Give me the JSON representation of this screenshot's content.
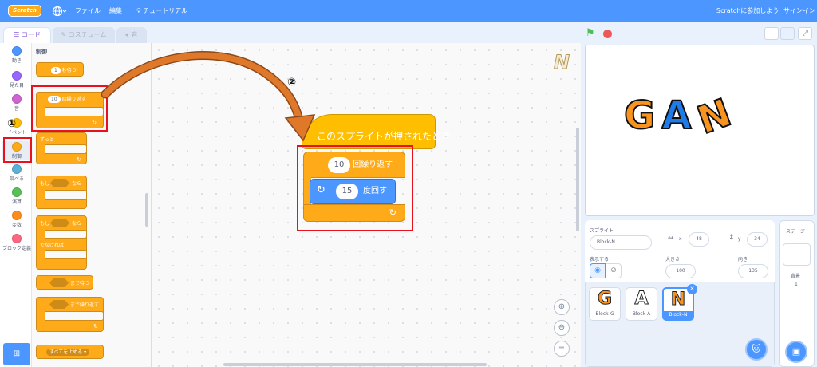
{
  "menubar": {
    "logo": "Scratch",
    "file": "ファイル",
    "edit": "編集",
    "tutorial": "チュートリアル",
    "join": "Scratchに参加しよう",
    "signin": "サインイン"
  },
  "tabs": {
    "code": "コード",
    "costume": "コスチューム",
    "sound": "音"
  },
  "categories": [
    {
      "label": "動き",
      "color": "#4c97ff"
    },
    {
      "label": "見た目",
      "color": "#9966ff"
    },
    {
      "label": "音",
      "color": "#cf63cf"
    },
    {
      "label": "イベント",
      "color": "#ffbf00"
    },
    {
      "label": "制御",
      "color": "#ffab19"
    },
    {
      "label": "調べる",
      "color": "#5cb1d6"
    },
    {
      "label": "演算",
      "color": "#59c059"
    },
    {
      "label": "変数",
      "color": "#ff8c1a"
    },
    {
      "label": "ブロック定義",
      "color": "#ff6680"
    }
  ],
  "palette": {
    "heading": "制御",
    "wait_num": "1",
    "wait_label": "秒待つ",
    "repeat_num": "10",
    "repeat_label": "回繰り返す",
    "forever": "ずっと",
    "if_then_if": "もし",
    "if_then_then": "なら",
    "if_else_if": "もし",
    "if_else_then": "なら",
    "else": "でなければ",
    "wait_until": "まで待つ",
    "repeat_until": "まで繰り返す",
    "stop_all": "すべてを止める ▾"
  },
  "script": {
    "hat": "このスプライトが押されたとき",
    "repeat_num": "10",
    "repeat_label": "回繰り返す",
    "turn_num": "15",
    "turn_label": "度回す"
  },
  "annotations": {
    "step1": "①",
    "step2": "②"
  },
  "stage": {
    "letters": [
      "G",
      "A",
      "N"
    ],
    "letter_colors": [
      "#f7931e",
      "#1e7be8",
      "#f7931e"
    ]
  },
  "sprite_info": {
    "sprite_label": "スプライト",
    "sprite_name": "Block-N",
    "x_label": "x",
    "x_value": "48",
    "y_label": "y",
    "y_value": "34",
    "show_label": "表示する",
    "size_label": "大きさ",
    "size_value": "100",
    "direction_label": "向き",
    "direction_value": "135"
  },
  "sprites": [
    {
      "letter": "G",
      "name": "Block-G",
      "color": "#f7931e"
    },
    {
      "letter": "A",
      "name": "Block-A",
      "color": "#1e7be8"
    },
    {
      "letter": "N",
      "name": "Block-N",
      "color": "#f7931e"
    }
  ],
  "stage_panel": {
    "title": "ステージ",
    "backdrop_label": "背景",
    "backdrop_count": "1"
  },
  "workspace_corner_letter": "N"
}
